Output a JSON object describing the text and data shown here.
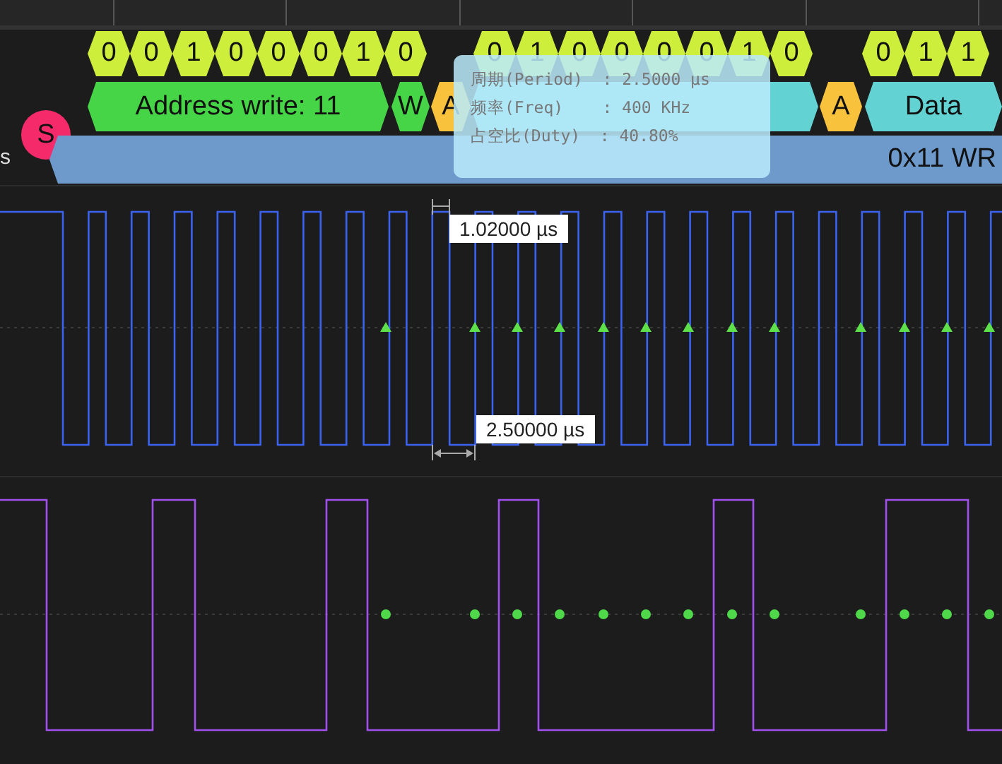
{
  "channel_label": "s",
  "bytes": [
    {
      "bits": [
        "0",
        "0",
        "1",
        "0",
        "0",
        "0",
        "1",
        "0"
      ]
    },
    {
      "bits": [
        "0",
        "1",
        "0",
        "0",
        "0",
        "0",
        "1",
        "0"
      ]
    },
    {
      "bits": [
        "0",
        "1",
        "1"
      ]
    }
  ],
  "frames": [
    {
      "kind": "start",
      "label": "S"
    },
    {
      "kind": "address",
      "label": "Address write: 11"
    },
    {
      "kind": "rw",
      "label": "W"
    },
    {
      "kind": "ack",
      "label": "A"
    },
    {
      "kind": "data"
    },
    {
      "kind": "ack",
      "label": "A"
    },
    {
      "kind": "data",
      "label": "Data"
    }
  ],
  "packet": {
    "label": "0x11 WR"
  },
  "tooltip": {
    "lines": [
      "周期(Period)  : 2.5000 μs",
      "频率(Freq)    : 400 KHz",
      "占空比(Duty)  : 40.80%"
    ]
  },
  "measurements": [
    {
      "label": "1.02000 µs"
    },
    {
      "label": "2.50000 µs"
    }
  ]
}
